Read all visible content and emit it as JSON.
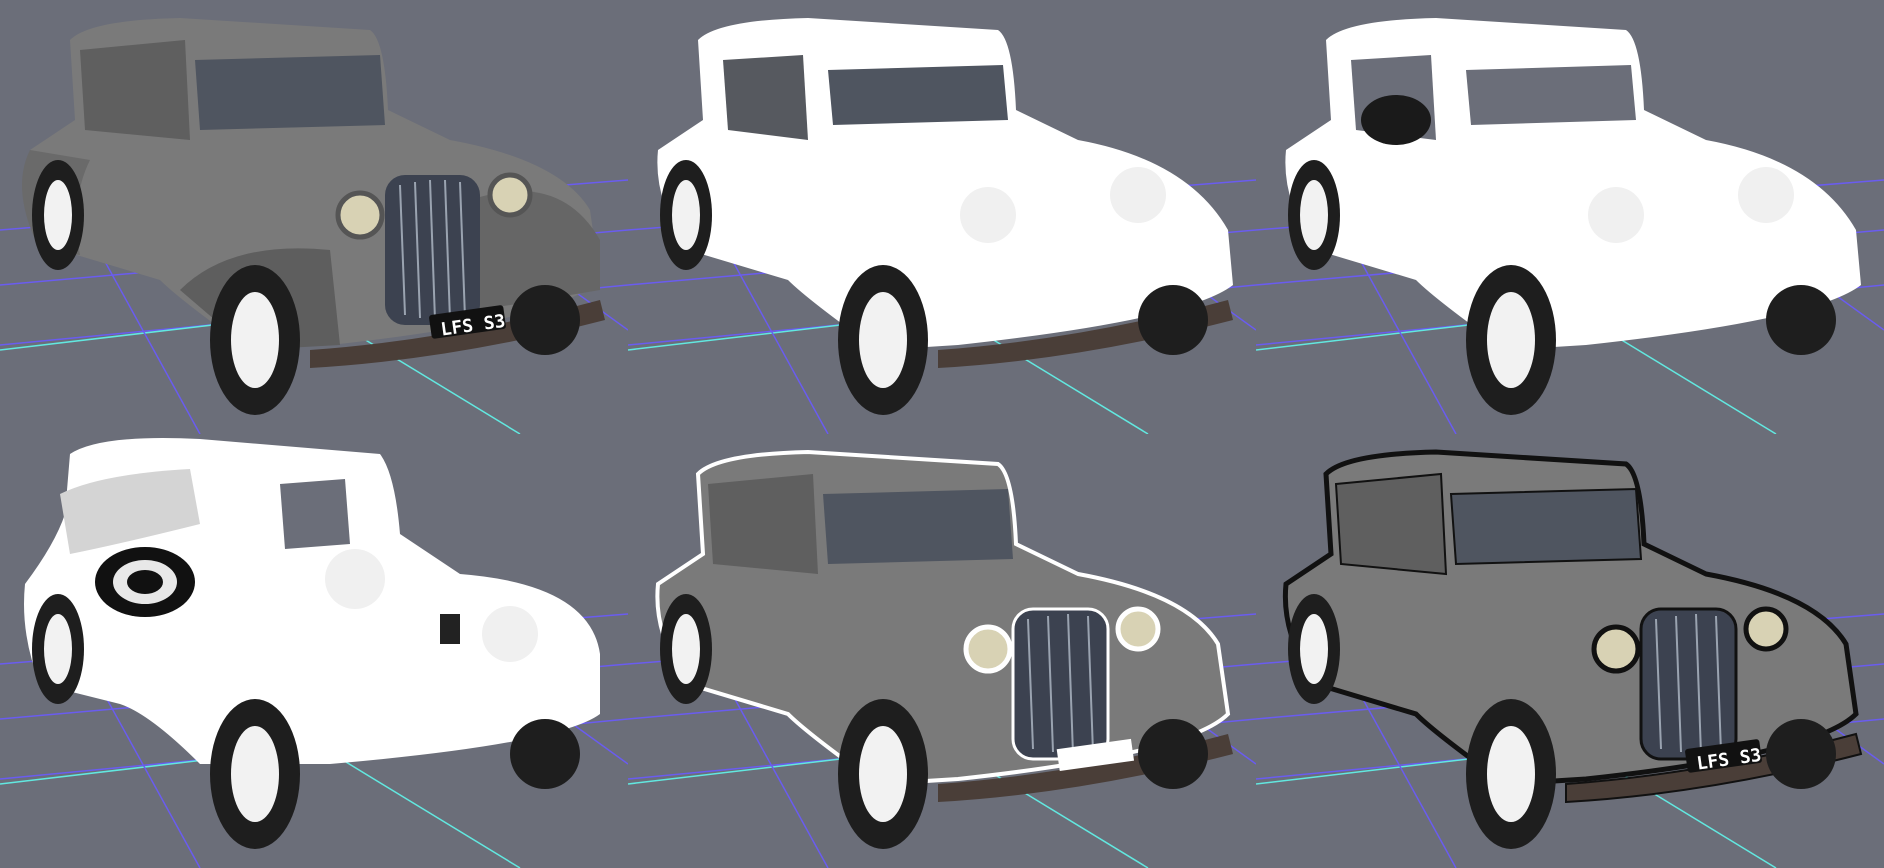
{
  "scene": {
    "background_color": "#6b6e79",
    "grid_color_primary": "#6a5cf0",
    "grid_color_axis": "#62e8e0",
    "panels": [
      {
        "id": "top-left",
        "variant": "shaded-gray",
        "plate": "LFS S3"
      },
      {
        "id": "top-middle",
        "variant": "white-body",
        "plate": ""
      },
      {
        "id": "top-right",
        "variant": "white-body-no-glass",
        "plate": ""
      },
      {
        "id": "bottom-left",
        "variant": "white-rear-view",
        "plate": ""
      },
      {
        "id": "bottom-middle",
        "variant": "gray-white-outline",
        "plate": ""
      },
      {
        "id": "bottom-right",
        "variant": "gray-black-outline",
        "plate": "LFS S3"
      }
    ]
  }
}
